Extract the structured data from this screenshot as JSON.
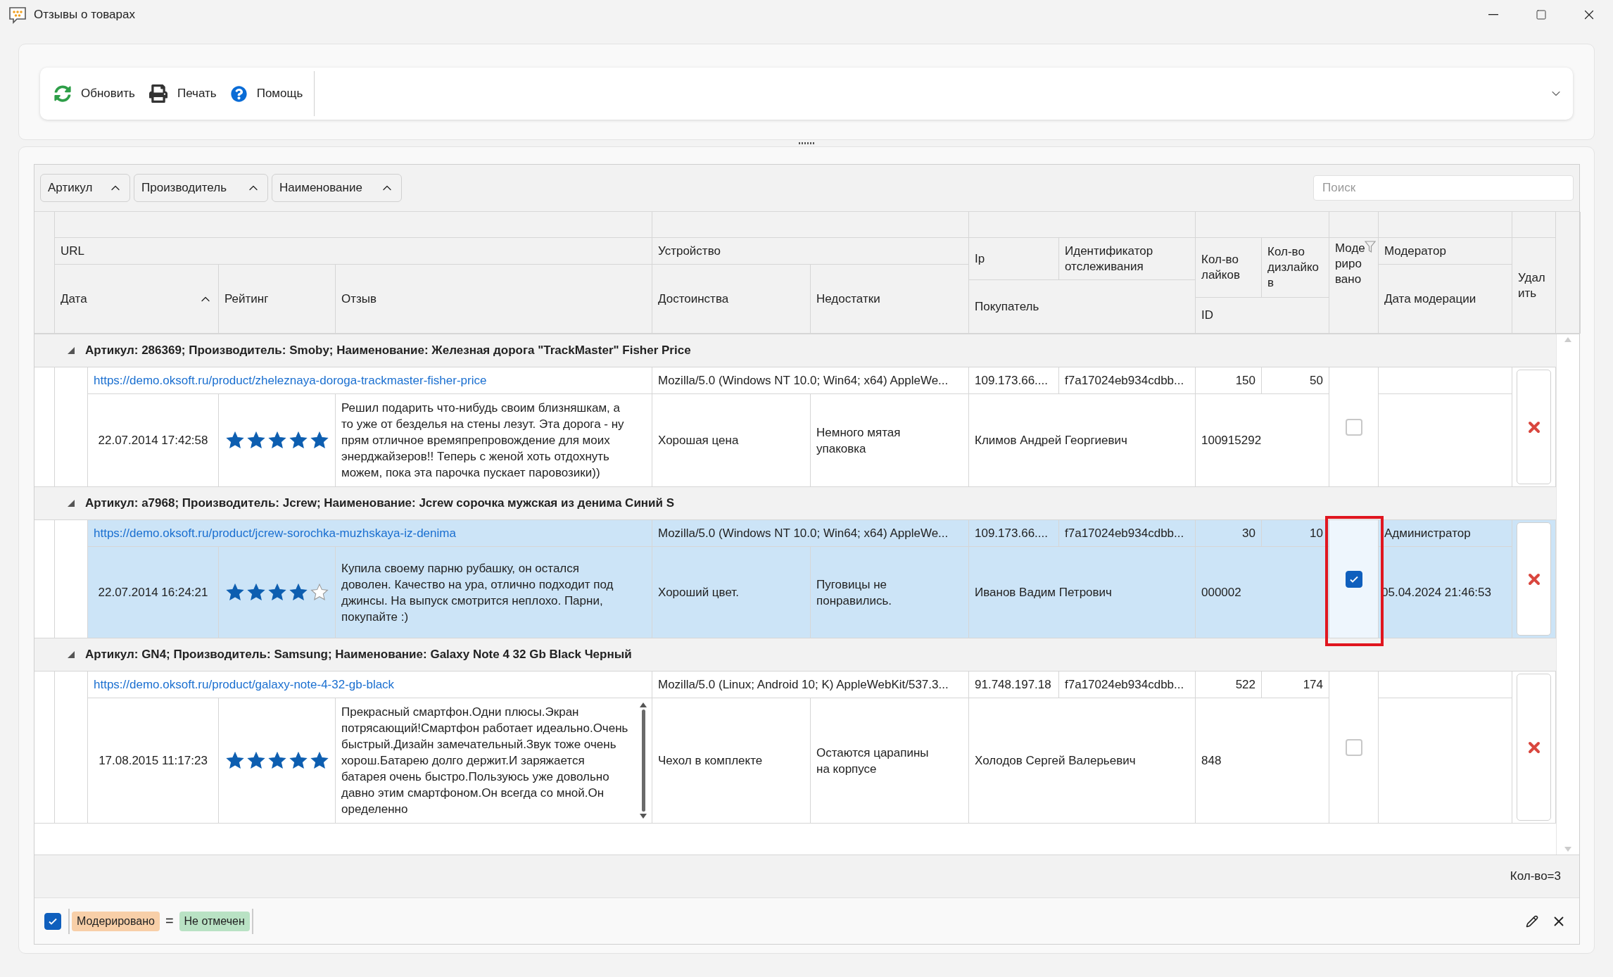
{
  "window": {
    "title": "Отзывы о товарах"
  },
  "toolbar": {
    "buttons": [
      {
        "kind": "refresh",
        "label": "Обновить"
      },
      {
        "kind": "print",
        "label": "Печать"
      },
      {
        "kind": "help",
        "label": "Помощь"
      }
    ]
  },
  "group_panel": [
    {
      "label": "Артикул",
      "sort_ascending": true
    },
    {
      "label": "Производитель",
      "sort_ascending": true
    },
    {
      "label": "Наименование",
      "sort_ascending": true
    }
  ],
  "search": {
    "placeholder": "Поиск"
  },
  "header": {
    "url": "URL",
    "device": "Устройство",
    "date": "Дата",
    "date_sort_ascending": true,
    "rating": "Рейтинг",
    "review": "Отзыв",
    "pros": "Достоинства",
    "cons": "Недостатки",
    "ip": "Ip",
    "tracking": "Идентификатор отслеживания",
    "buyer": "Покупатель",
    "likes": "Кол-во лайков",
    "dislikes": "Кол-во дизлайков",
    "id": "ID",
    "moderated": "Модерировано",
    "moderated_filtered": true,
    "moderator": "Модератор",
    "moderation_date": "Дата модерации",
    "delete": "Удалить"
  },
  "groups": [
    {
      "title": "Артикул: 286369; Производитель: Smoby; Наименование: Железная дорога \"TrackMaster\" Fisher Price",
      "expanded": true,
      "records": [
        {
          "url": "https://demo.oksoft.ru/product/zheleznaya-doroga-trackmaster-fisher-price",
          "device": "Mozilla/5.0 (Windows NT 10.0; Win64; x64) AppleWe...",
          "ip": "109.173.66....",
          "tracking": "f7a17024eb934cdbb...",
          "likes": "150",
          "dislikes": "50",
          "date": "22.07.2014 17:42:58",
          "stars": 5,
          "review": "Решил подарить что-нибудь своим близняшкам, а то уже от безделья на стены лезут. Эта дорога - ну прям отличное времяпрепровождение для моих энерджайзеров!! Теперь с женой хоть отдохнуть можем, пока эта парочка пускает паровозики))",
          "pros": "Хорошая цена",
          "cons": "Немного мятая упаковка",
          "buyer": "Климов Андрей Георгиевич",
          "id": "100915292",
          "moderated": false,
          "selected": false,
          "highlighted": false
        }
      ]
    },
    {
      "title": "Артикул: a7968; Производитель: Jcrew; Наименование: Jcrew сорочка мужская из денима Синий S",
      "expanded": true,
      "records": [
        {
          "url": "https://demo.oksoft.ru/product/jcrew-sorochka-muzhskaya-iz-denima",
          "device": "Mozilla/5.0 (Windows NT 10.0; Win64; x64) AppleWe...",
          "ip": "109.173.66....",
          "tracking": "f7a17024eb934cdbb...",
          "likes": "30",
          "dislikes": "10",
          "moderator": "Администратор",
          "date": "22.07.2014 16:24:21",
          "stars": 4,
          "review": "Купила своему парню рубашку, он остался доволен. Качество на ура, отлично подходит под джинсы. На выпуск смотрится неплохо. Парни, покупайте :)",
          "pros": "Хороший цвет.",
          "cons": "Пуговицы не понравились.",
          "buyer": "Иванов Вадим Петрович",
          "id": "000002",
          "moderated": true,
          "moderation_date": "05.04.2024 21:46:53",
          "selected": true,
          "highlighted": true
        }
      ]
    },
    {
      "title": "Артикул: GN4; Производитель: Samsung; Наименование: Galaxy Note 4 32 Gb Black Черный",
      "expanded": true,
      "records": [
        {
          "url": "https://demo.oksoft.ru/product/galaxy-note-4-32-gb-black",
          "device": "Mozilla/5.0 (Linux; Android 10; K) AppleWebKit/537.3...",
          "ip": "91.748.197.18",
          "tracking": "f7a17024eb934cdbb...",
          "likes": "522",
          "dislikes": "174",
          "date": "17.08.2015 11:17:23",
          "stars": 5,
          "review": "Прекрасный смартфон.Одни плюсы.Экран потрясающий!Смартфон работает идеально.Очень быстрый.Дизайн замечательный.Звук тоже очень хорош.Батарею долго держит.И заряжается батарея очень быстро.Пользуюсь уже довольно давно этим смартфоном.Он всегда со мной.Он оределенно",
          "pros": "Чехол в комплекте",
          "cons": "Остаются царапины на корпусе",
          "buyer": "Холодов Сергей Валерьевич",
          "id": "848",
          "moderated": false,
          "selected": false,
          "highlighted": false
        }
      ]
    }
  ],
  "summary": "Кол-во=3",
  "filter": {
    "enabled": true,
    "field": "Модерировано",
    "operator": "=",
    "value": "Не отмечен"
  }
}
